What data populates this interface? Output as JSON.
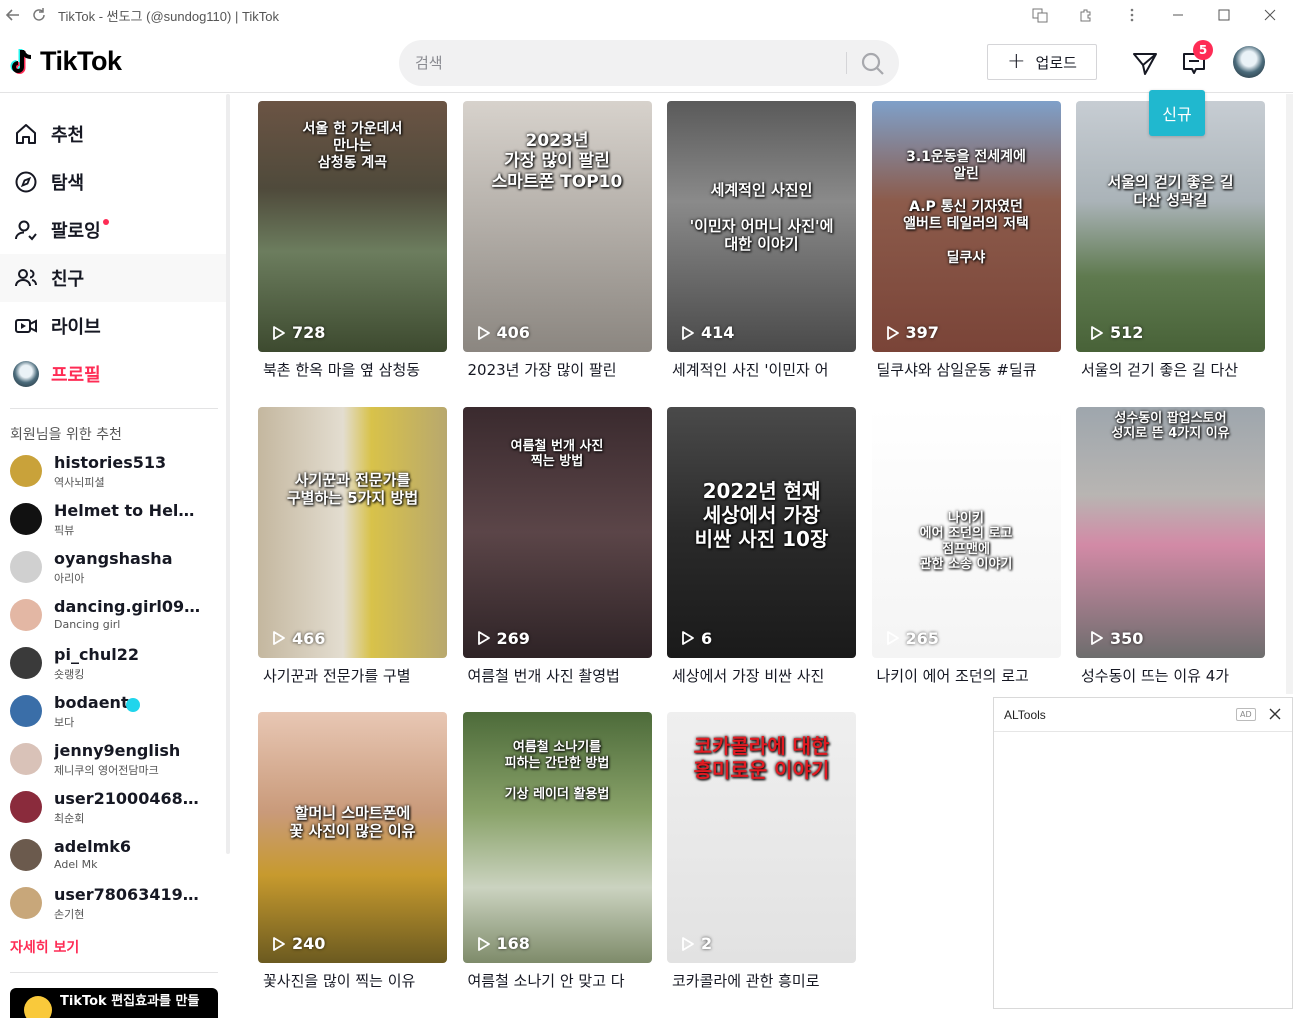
{
  "window": {
    "title": "TikTok - 썬도그 (@sundog110) | TikTok"
  },
  "header": {
    "logo_text": "TikTok",
    "search_placeholder": "검색",
    "upload_label": "업로드",
    "inbox_badge": "5"
  },
  "sidebar": {
    "nav": [
      {
        "label": "추천",
        "icon": "home-icon"
      },
      {
        "label": "탐색",
        "icon": "compass-icon"
      },
      {
        "label": "팔로잉",
        "icon": "following-icon",
        "dot": true
      },
      {
        "label": "친구",
        "icon": "friends-icon"
      },
      {
        "label": "라이브",
        "icon": "live-icon"
      },
      {
        "label": "프로필",
        "icon": "profile-avatar"
      }
    ],
    "suggested_title": "회원님을 위한 추천",
    "accounts": [
      {
        "name": "histories513",
        "sub": "역사뇌피셜",
        "color": "#c9a23a"
      },
      {
        "name": "Helmet to Helme...",
        "sub": "픽뷰",
        "color": "#111111"
      },
      {
        "name": "oyangshasha",
        "sub": "아리아",
        "color": "#d0d0d0"
      },
      {
        "name": "dancing.girl0946",
        "sub": "Dancing girl",
        "color": "#e3b7a4"
      },
      {
        "name": "pi_chul22",
        "sub": "숏랭킹",
        "color": "#3a3a3a"
      },
      {
        "name": "bodaent",
        "sub": "보다",
        "color": "#3a6ea8",
        "verified": true
      },
      {
        "name": "jenny9english",
        "sub": "제니쿠의 영어전담마크",
        "color": "#d9c2b8"
      },
      {
        "name": "user210004681...",
        "sub": "최순회",
        "color": "#8a2b3c"
      },
      {
        "name": "adelmk6",
        "sub": "Adel Mk",
        "color": "#6b5a4d"
      },
      {
        "name": "user7806341939...",
        "sub": "손기현",
        "color": "#c8a77a"
      }
    ],
    "see_more": "자세히 보기",
    "promo_text": "TikTok 편집효과를 만들"
  },
  "new_tag": "신규",
  "videos": [
    {
      "views": "728",
      "caption": "북촌 한옥 마을 옆 삼청동",
      "overlay": "서울 한 가운데서\n만나는\n삼청동 계곡",
      "bg": "linear-gradient(180deg,#6b5444 0%,#4f4a3b 35%,#6c7d5e 60%,#3d4a2f 100%)",
      "fs": 14,
      "oy": 20
    },
    {
      "views": "406",
      "caption": "2023년 가장 많이 팔린",
      "overlay": "2023년\n가장 많이 팔린\n스마트폰 TOP10",
      "bg": "linear-gradient(180deg,#d7d2cc 0%,#b6b1ab 45%,#8b8680 100%)",
      "fs": 17,
      "oy": 30
    },
    {
      "views": "414",
      "caption": "세계적인 사진 '이민자 어",
      "overlay": "세계적인 사진인\n\n'이민자 어머니 사진'에\n대한 이야기",
      "bg": "linear-gradient(180deg,#5a5a5a 0%,#8a8a8a 40%,#4a4a4a 100%)",
      "fs": 15,
      "oy": 80
    },
    {
      "views": "397",
      "caption": "딜쿠샤와 삼일운동 #딜큐",
      "overlay": "3.1운동을 전세계에\n알린\n\nA.P 통신 기자였던\n앨버트 테일러의 저택\n\n딜쿠샤",
      "bg": "linear-gradient(180deg,#7fa0c9 0%,#8c5b4b 40%,#7a4438 100%)",
      "fs": 14,
      "oy": 48
    },
    {
      "views": "512",
      "caption": "서울의 걷기 좋은 길 다산",
      "overlay": "서울의 걷기 좋은 길\n다산 성곽길",
      "bg": "linear-gradient(180deg,#c7cdd3 0%,#aab3b8 40%,#5f7a4f 70%,#486238 100%)",
      "fs": 15,
      "oy": 72
    },
    {
      "views": "466",
      "caption": "사기꾼과 전문가를 구별",
      "overlay": "사기꾼과 전문가를\n구별하는 5가지 방법",
      "bg": "linear-gradient(90deg,#c4b79f 0%,#e3ddd0 45%,#d8c24a 60%,#b8a86e 100%)",
      "fs": 15,
      "oy": 64
    },
    {
      "views": "269",
      "caption": "여름철 번개 사진 촬영법",
      "overlay": "여름철 번개 사진\n찍는 방법",
      "bg": "linear-gradient(180deg,#3a2a2e 0%,#5b4548 50%,#2e2326 100%)",
      "fs": 13,
      "oy": 32
    },
    {
      "views": "6",
      "caption": "세상에서 가장 비싼 사진",
      "overlay": "2022년 현재\n세상에서 가장\n비싼 사진 10장",
      "bg": "linear-gradient(180deg,#4a4a4a 0%,#2a2a2a 50%,#1a1a1a 100%)",
      "fs": 20,
      "oy": 72
    },
    {
      "views": "265",
      "caption": "나키이 에어 조던의 로고",
      "overlay": "나이키\n에어 조던의 로고\n점프맨에\n관한 소송 이야기",
      "bg": "linear-gradient(180deg,#ffffff 0%,#f4f4f4 100%)",
      "fs": 13,
      "oy": 104
    },
    {
      "views": "350",
      "caption": "성수동이 뜨는 이유 4가",
      "overlay": "성수동이 팝업스토어\n성지로 뜬 4가지 이유",
      "bg": "linear-gradient(180deg,#9ea6ad 0%,#b8b5b2 35%,#d28aa6 55%,#6d6d6d 100%)",
      "fs": 13,
      "oy": 4
    },
    {
      "views": "240",
      "caption": "꽃사진을 많이 찍는 이유",
      "overlay": "할머니 스마트폰에\n꽃 사진이 많은 이유",
      "bg": "linear-gradient(180deg,#e8c7b4 0%,#c99a7a 40%,#c79a2e 65%,#6b5a20 100%)",
      "fs": 15,
      "oy": 92
    },
    {
      "views": "168",
      "caption": "여름철 소나기 안 맞고 다",
      "overlay": "여름철 소나기를\n피하는 간단한 방법\n\n기상 레이더 활용법",
      "bg": "linear-gradient(180deg,#4d6b3a 0%,#8aa36a 40%,#cbd3c0 70%,#7e8b6a 100%)",
      "fs": 13,
      "oy": 28
    },
    {
      "views": "2",
      "caption": "코카콜라에 관한 흥미로",
      "overlay": "코카콜라에 대한\n흥미로운 이야기",
      "bg": "linear-gradient(180deg,#efefef 0%,#e2e2e2 100%)",
      "fs": 20,
      "oy": 22
    }
  ],
  "altools": {
    "title": "ALTools",
    "ad_label": "AD"
  }
}
